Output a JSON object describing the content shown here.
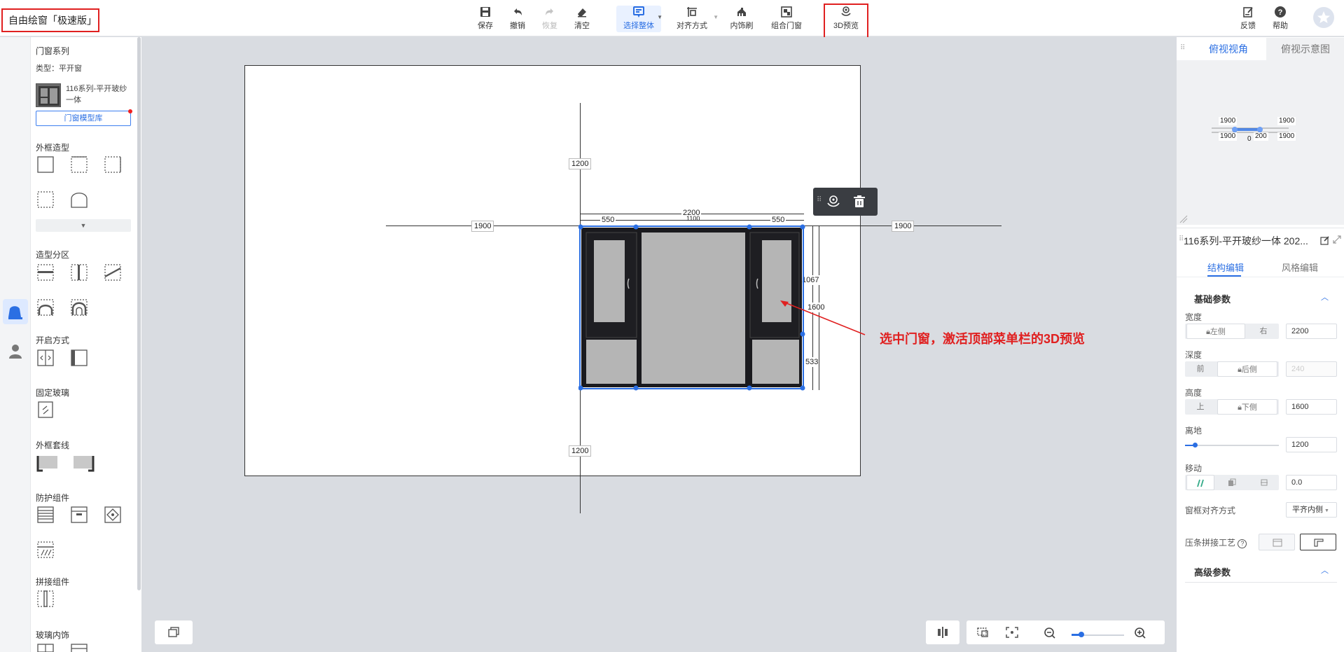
{
  "app": {
    "title": "自由绘窗「极速版」"
  },
  "toolbar": {
    "save": "保存",
    "undo": "撤销",
    "redo": "恢复",
    "clear": "清空",
    "select_all": "选择整体",
    "align": "对齐方式",
    "inner_trim": "内饰刷",
    "combo": "组合门窗",
    "preview3d": "3D预览",
    "feedback": "反馈",
    "help": "帮助"
  },
  "left_panel": {
    "series_title": "门窗系列",
    "type_line": "类型：平开窗",
    "model_name": "116系列-平开玻纱一体",
    "library_button": "门窗模型库",
    "sections": {
      "outer_frame": "外框造型",
      "partition": "造型分区",
      "opening": "开启方式",
      "fixed_glass": "固定玻璃",
      "frame_trim": "外框套线",
      "protection": "防护组件",
      "splice": "拼接组件",
      "glass_deco": "玻璃内饰"
    }
  },
  "canvas": {
    "dims": {
      "top_height": "1200",
      "bottom_height": "1200",
      "left_width": "1900",
      "right_width": "1900",
      "total_width": "2200",
      "left_sash": "550",
      "right_sash": "550",
      "mid_hidden": "1100",
      "upper_height": "1067",
      "total_height": "1600",
      "lower_height": "533"
    },
    "annotation": "选中门窗，激活顶部菜单栏的3D预览"
  },
  "right_panel": {
    "view_tabs": [
      "俯视视角",
      "俯视示意图"
    ],
    "minimap": {
      "tl": "1900",
      "tr": "1900",
      "bl": "1900",
      "br": "1900",
      "mid": "200",
      "zero": "0"
    },
    "prop_title": "116系列-平开玻纱一体 202...",
    "sub_tabs": [
      "结构编辑",
      "风格编辑"
    ],
    "basic_params": "基础参数",
    "width": {
      "label": "宽度",
      "left": "左侧",
      "right": "右",
      "value": "2200"
    },
    "depth": {
      "label": "深度",
      "front": "前",
      "back": "后侧",
      "value": "240"
    },
    "height": {
      "label": "高度",
      "up": "上",
      "down": "下侧",
      "value": "1600"
    },
    "elevation": {
      "label": "离地",
      "value": "1200"
    },
    "move": {
      "label": "移动",
      "value": "0.0"
    },
    "frame_align": {
      "label": "窗框对齐方式",
      "value": "平齐内侧"
    },
    "bead_craft": {
      "label": "压条拼接工艺"
    },
    "advanced_params": "高级参数"
  },
  "colors": {
    "accent": "#2b6fe3",
    "highlight": "#e02020",
    "frame": "#1a1a1e",
    "glass": "#b5b5b5"
  }
}
